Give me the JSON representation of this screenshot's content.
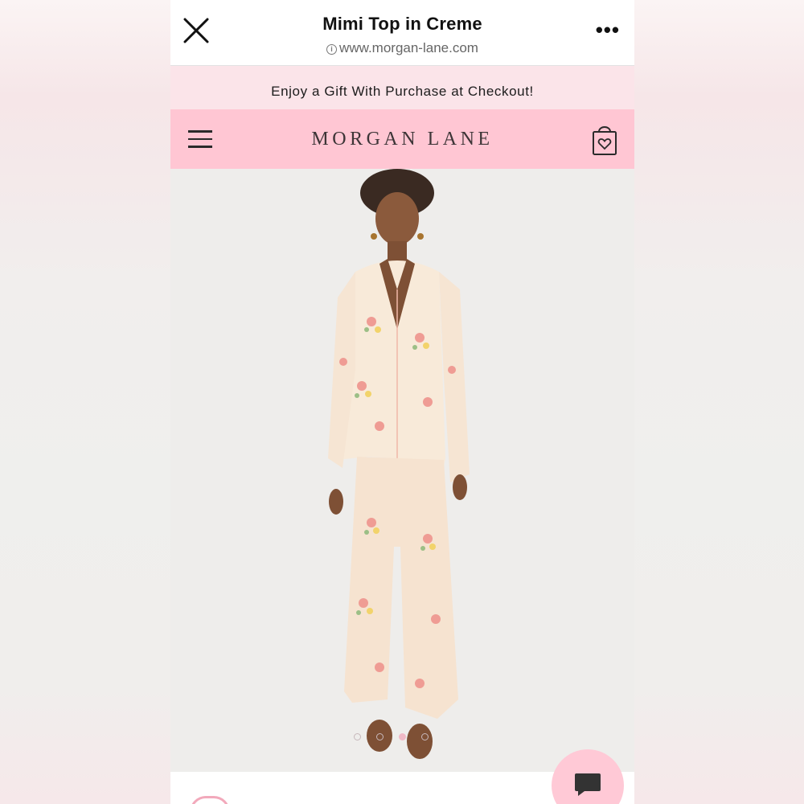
{
  "browser": {
    "title": "Mimi Top in Creme",
    "url": "www.morgan-lane.com",
    "more_label": "•••"
  },
  "promo": {
    "text": "Enjoy a Gift With Purchase at Checkout!"
  },
  "header": {
    "brand": "MORGAN LANE",
    "menu_icon": "hamburger-menu-icon",
    "cart_icon": "heart-shopping-bag-icon"
  },
  "product": {
    "image_description": "model-in-floral-silk-pajama-set",
    "carousel": {
      "total": 4,
      "active_index": 3
    }
  },
  "chat": {
    "icon": "chat-bubble-icon"
  },
  "colors": {
    "header_pink": "#ffc6d3",
    "promo_pink": "#fbe4e9",
    "chat_pink": "#ffc9d6",
    "text_dark": "#1c1c1c"
  }
}
